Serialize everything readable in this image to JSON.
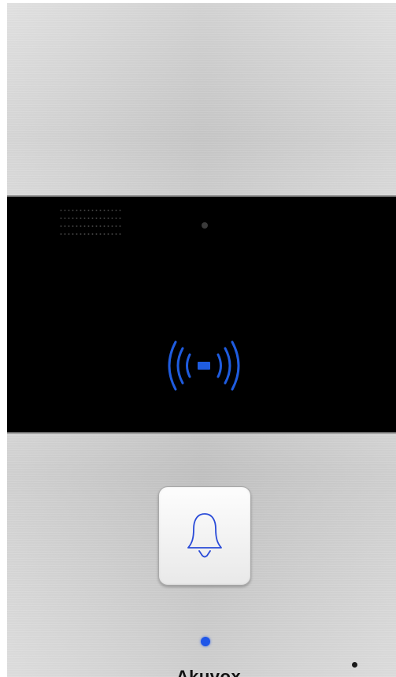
{
  "device": {
    "brand": "Akuvox",
    "indicator_color": "#1f56e8",
    "rfid_icon_color": "#1f5ce0",
    "bell_icon_color": "#2a4bd8"
  },
  "panel": {
    "speaker": "speaker-grille-icon",
    "rfid_icon": "rfid-card-icon",
    "mic": "microphone-hole"
  },
  "call_button": {
    "icon": "bell-icon"
  }
}
